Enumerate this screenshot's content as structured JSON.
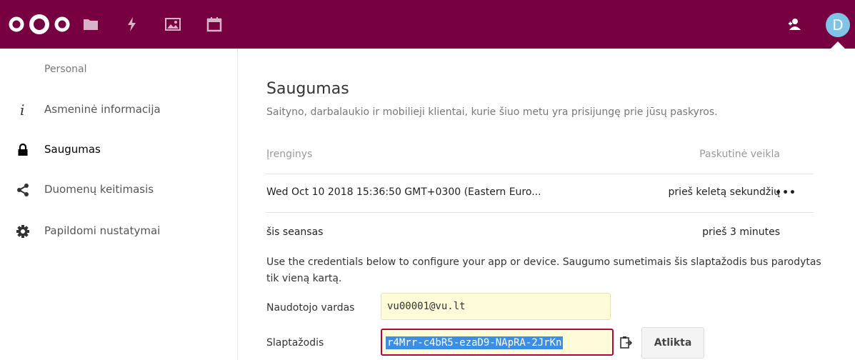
{
  "header": {
    "apps": [
      {
        "name": "folder-icon"
      },
      {
        "name": "activity-icon"
      },
      {
        "name": "gallery-icon"
      },
      {
        "name": "calendar-icon"
      }
    ],
    "avatar_initial": "D",
    "brand_color": "#770040"
  },
  "sidebar": {
    "caption": "Personal",
    "items": [
      {
        "icon": "info-icon",
        "label": "Asmeninė informacija"
      },
      {
        "icon": "lock-icon",
        "label": "Saugumas",
        "active": true
      },
      {
        "icon": "share-icon",
        "label": "Duomenų keitimasis"
      },
      {
        "icon": "gear-icon",
        "label": "Papildomi nustatymai"
      }
    ]
  },
  "main": {
    "title": "Saugumas",
    "description": "Saityno, darbalaukio ir mobilieji klientai, kurie šiuo metu yra prisijungę prie jūsų paskyros.",
    "table": {
      "col_device": "Įrenginys",
      "col_last_activity": "Paskutinė veikla",
      "rows": [
        {
          "device": "Wed Oct 10 2018 15:36:50 GMT+0300 (Eastern Euro...",
          "last_activity": "prieš keletą sekundžių",
          "more": "•••"
        },
        {
          "device": "šis seansas",
          "last_activity": "prieš 3 minutes"
        }
      ]
    },
    "info_text": "Use the credentials below to configure your app or device. Saugumo sumetimais šis slaptažodis bus parodytas tik vieną kartą.",
    "username_label": "Naudotojo vardas",
    "username_value": "vu00001@vu.lt",
    "password_label": "Slaptažodis",
    "password_value": "r4Mrr-c4bR5-ezaD9-NApRA-2JrKn",
    "done_label": "Atlikta"
  }
}
